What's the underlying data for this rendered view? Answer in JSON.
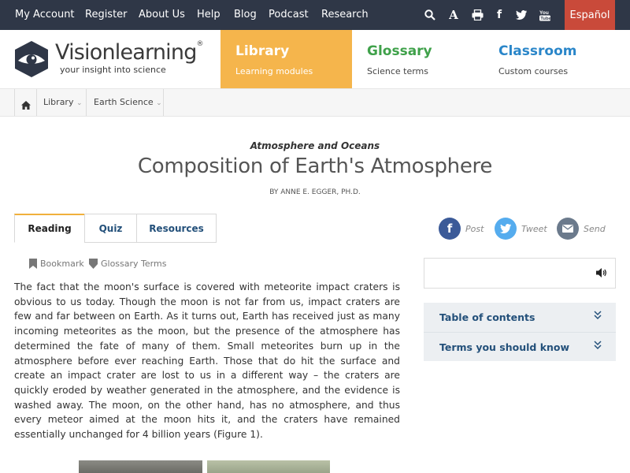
{
  "topnav": {
    "links": [
      "My Account",
      "Register",
      "About Us",
      "Help",
      "Blog",
      "Podcast",
      "Research"
    ],
    "icons": [
      "search-icon",
      "font-size-icon",
      "print-icon",
      "facebook-icon",
      "twitter-icon",
      "youtube-icon"
    ],
    "language": "Español"
  },
  "header": {
    "logo_name": "Visionlearning",
    "logo_mark": "®",
    "tagline": "your insight into science",
    "tabs": [
      {
        "title": "Library",
        "subtitle": "Learning modules",
        "color": "#f5b54c"
      },
      {
        "title": "Glossary",
        "subtitle": "Science terms",
        "color": "#3fa14a"
      },
      {
        "title": "Classroom",
        "subtitle": "Custom courses",
        "color": "#2a86c9"
      }
    ]
  },
  "breadcrumb": {
    "home_icon": "home-icon",
    "items": [
      "Library",
      "Earth Science"
    ]
  },
  "article": {
    "category": "Atmosphere and Oceans",
    "title": "Composition of Earth's Atmosphere",
    "author": "BY ANNE E. EGGER, PH.D.",
    "tabs": [
      "Reading",
      "Quiz",
      "Resources"
    ],
    "active_tab": "Reading",
    "tools": [
      "Bookmark",
      "Glossary Terms"
    ],
    "body": "The fact that the moon's surface is covered with meteorite impact craters is obvious to us today. Though the moon is not far from us, impact craters are few and far between on Earth. As it turns out, Earth has received just as many incoming meteorites as the moon, but the presence of the atmosphere has determined the fate of many of them. Small meteorites burn up in the atmosphere before ever reaching Earth. Those that do hit the surface and create an impact crater are lost to us in a different way – the craters are quickly eroded by weather generated in the atmosphere, and the evidence is washed away. The moon, on the other hand, has no atmosphere, and thus every meteor aimed at the moon hits it, and the craters have remained essentially unchanged for 4 billion years (Figure 1)."
  },
  "share": [
    {
      "label": "Post",
      "icon": "facebook-icon",
      "color": "#3b5a98",
      "glyph": "f"
    },
    {
      "label": "Tweet",
      "icon": "twitter-icon",
      "color": "#55acee",
      "glyph": "t"
    },
    {
      "label": "Send",
      "icon": "email-icon",
      "color": "#6b7a8c",
      "glyph": "✉"
    }
  ],
  "sidebar": {
    "audio_icon": "speaker-icon",
    "panels": [
      "Table of contents",
      "Terms you should know"
    ]
  }
}
